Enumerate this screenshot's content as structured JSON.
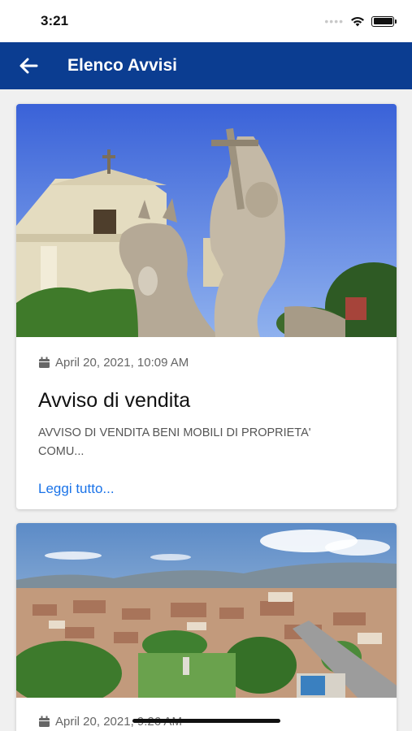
{
  "status_bar": {
    "time": "3:21"
  },
  "header": {
    "title": "Elenco Avvisi",
    "back_icon": "arrow-left-icon"
  },
  "cards": [
    {
      "date": "April 20, 2021, 10:09 AM",
      "title": "Avviso di vendita",
      "excerpt": "AVVISO DI VENDITA BENI MOBILI DI PROPRIETA' COMU...",
      "link": "Leggi tutto..."
    },
    {
      "date": "April 20, 2021, 9:26 AM"
    }
  ],
  "colors": {
    "header": "#0b3d91",
    "link": "#1a73e8"
  }
}
